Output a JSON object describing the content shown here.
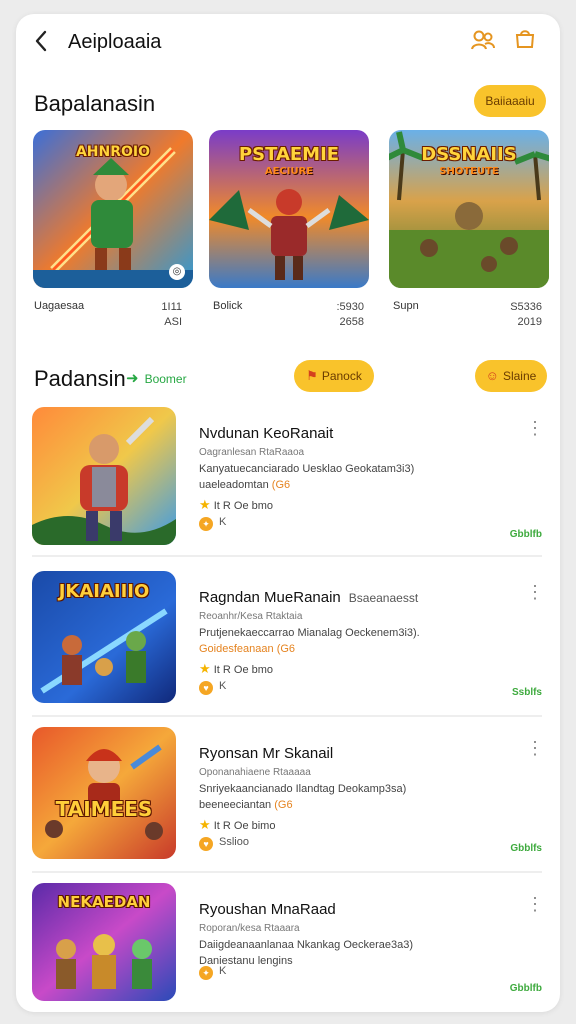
{
  "header": {
    "title": "Aeiploaaia",
    "back_icon": "chevron-left-icon",
    "people_icon": "people-icon",
    "store_icon": "store-icon"
  },
  "featured": {
    "title": "Bapalanasin",
    "action_label": "Baiiaaaiu",
    "items": [
      {
        "name": "Uagaesaa",
        "stat1": "1I11",
        "stat2": "ASI",
        "art_title": "AHNROIO",
        "art_subtitle": "",
        "has_badge": true
      },
      {
        "name": "Bolick",
        "stat1": ":5930",
        "stat2": "2658",
        "art_title": "PSTAEMIE",
        "art_subtitle": "AECIURE",
        "has_badge": false
      },
      {
        "name": "Supn",
        "stat1": "S5336",
        "stat2": "2019",
        "art_title": "DSSNAIIS",
        "art_subtitle": "SHOTEUTE",
        "has_badge": false
      }
    ]
  },
  "list_section": {
    "title": "Padansin",
    "new_label": "Boomer",
    "filter_left": "Panock",
    "filter_right": "Slaine",
    "items": [
      {
        "title": "Nvdunan KeoRanait",
        "title_suffix": "",
        "subtitle": "Oagranlesan      RtaRaaoa",
        "desc": "Kanyatuecanciarado Uesklao Geokatam3i3)",
        "desc2": "uaeleadomtan",
        "tag": "(G6",
        "rating": "It  R Oe bmo",
        "extra": "K",
        "status": "Gbblfb",
        "art_title": ""
      },
      {
        "title": "Ragndan MueRanain",
        "title_suffix": "Bsaeanaesst",
        "subtitle": "Reoanhr/Kesa     Rtaktaia",
        "desc": "Prutjenekaeccarrao Mianalag Oeckenem3i3).",
        "desc2": "Goidesfeanaan",
        "tag": "(G6",
        "rating": "It  R Oe bmo",
        "extra": "K",
        "status": "Ssblfs",
        "art_title": "JKAIAIIIO"
      },
      {
        "title": "Ryonsan Mr Skanail",
        "title_suffix": "",
        "subtitle": "Oponanahiaene      Rtaaaaa",
        "desc": "Snriyekaancianado Ilandtag Deokamp3sa)",
        "desc2": "beeneeciantan",
        "tag": "(G6",
        "rating": "It  R Oe bimo",
        "extra": "Sslioo",
        "status": "Gbblfs",
        "art_title": "TAIMEES"
      },
      {
        "title": "Ryoushan MnaRaad",
        "title_suffix": "",
        "subtitle": "Roporan/kesa      Rtaaara",
        "desc": "Daiigdeanaanlanaa Nkankag Oeckerae3a3)",
        "desc2": "Daniestanu lengins",
        "tag": "",
        "rating": "",
        "extra": "K",
        "status": "Gbblfb",
        "art_title": "NEKAEDAN"
      }
    ]
  },
  "colors": {
    "accent_yellow": "#f9c32b",
    "accent_green": "#27a844",
    "accent_orange": "#e59520"
  }
}
